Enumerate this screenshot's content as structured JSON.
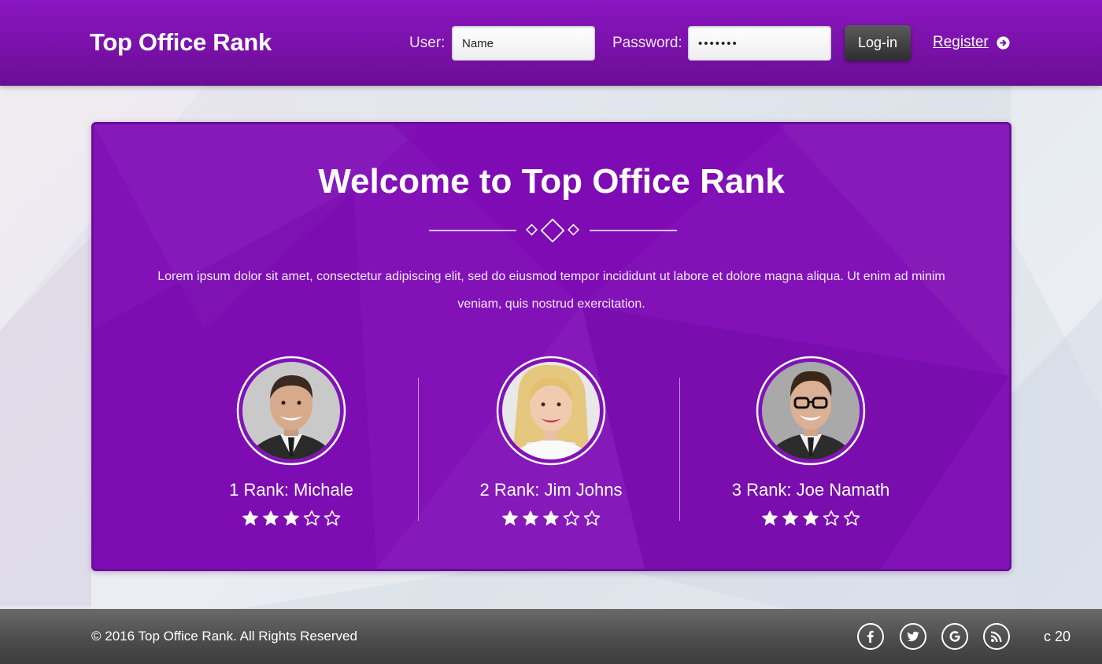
{
  "header": {
    "brand": "Top Office Rank",
    "user_label": "User:",
    "user_value": "Name",
    "password_label": "Password:",
    "password_value": "*******",
    "login_label": "Log-in",
    "register_label": "Register",
    "register_icon": "arrow-circle-right-icon"
  },
  "main": {
    "title": "Welcome to Top Office Rank",
    "intro": "Lorem ipsum dolor sit amet, consectetur adipiscing elit, sed do eiusmod tempor incididunt ut labore et dolore magna aliqua. Ut enim ad minim veniam, quis nostrud exercitation.",
    "ranks": [
      {
        "label": "1 Rank: Michale",
        "rating": 3,
        "max_rating": 5
      },
      {
        "label": "2 Rank: Jim Johns",
        "rating": 3,
        "max_rating": 5
      },
      {
        "label": "3 Rank: Joe Namath",
        "rating": 3,
        "max_rating": 5
      }
    ]
  },
  "footer": {
    "copyright": "© 2016 Top Office Rank. All Rights Reserved",
    "social": [
      "facebook-icon",
      "twitter-icon",
      "google-icon",
      "rss-icon"
    ],
    "corner_text": "c 20"
  },
  "colors": {
    "header": "#7d12ae",
    "card": "#8212b8",
    "footer": "#4d4d4d",
    "accent_text": "#ffffff"
  }
}
